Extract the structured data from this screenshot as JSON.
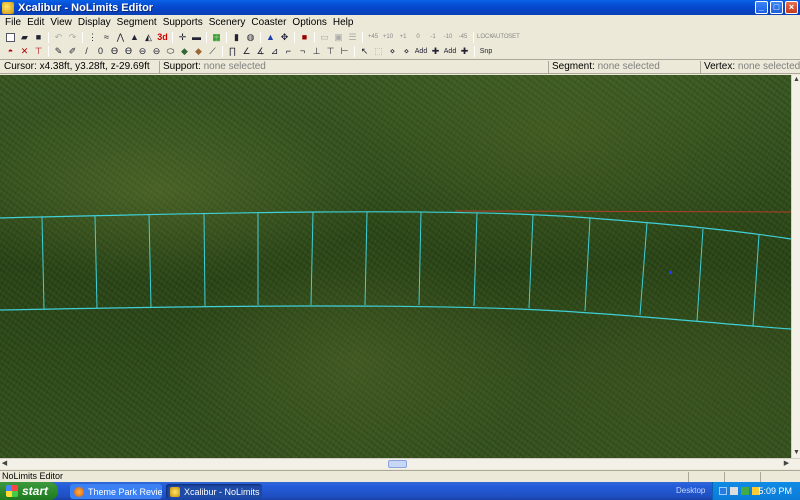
{
  "window": {
    "title": "Xcalibur - NoLimits Editor"
  },
  "window_buttons": {
    "minimize": "_",
    "maximize": "□",
    "close": "×"
  },
  "menu": [
    "File",
    "Edit",
    "View",
    "Display",
    "Segment",
    "Supports",
    "Scenery",
    "Coaster",
    "Options",
    "Help"
  ],
  "toolbar": {
    "three_d_label": "3d",
    "snap_label": "Snp",
    "add_label_1": "Add",
    "add_label_2": "Add"
  },
  "status": {
    "cursor_label": "Cursor:",
    "cursor_value": "x4.38ft, y3.28ft, z-29.69ft",
    "support_label": "Support:",
    "support_value": "none selected",
    "segment_label": "Segment:",
    "segment_value": "none selected",
    "vertex_label": "Vertex:",
    "vertex_value": "none selected"
  },
  "bottom_status": {
    "text": "NoLimits Editor"
  },
  "taskbar": {
    "start_label": "start",
    "tasks": [
      {
        "label": "Theme Park Review :..."
      },
      {
        "label": "Xcalibur - NoLimits Edi..."
      }
    ],
    "desktop_label": "Desktop",
    "clock": "5:09 PM"
  },
  "colors": {
    "track": "#3fd0d8",
    "reference_line": "#b0402a",
    "vertex_marker": "#1e3cff"
  }
}
